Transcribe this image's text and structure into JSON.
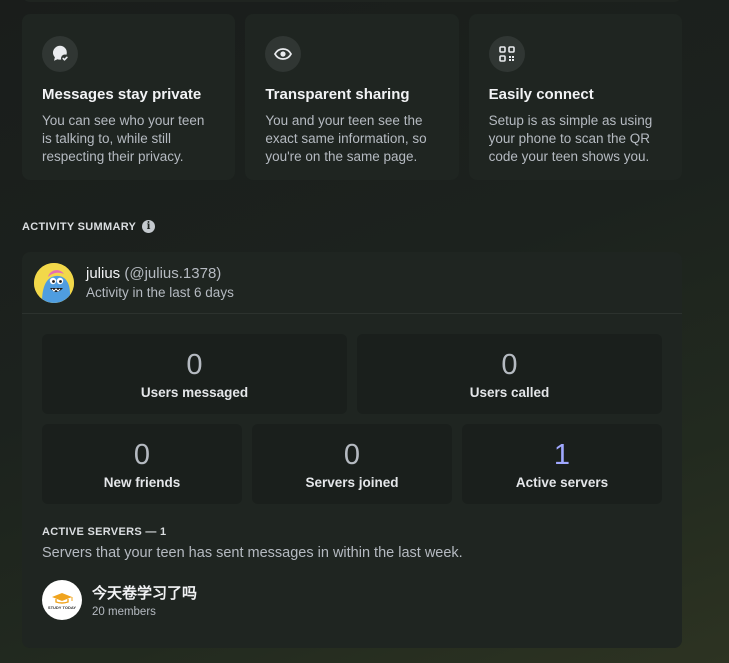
{
  "features": [
    {
      "icon": "chat-check-icon",
      "title": "Messages stay private",
      "description": "You can see who your teen is talking to, while still respecting their privacy."
    },
    {
      "icon": "eye-icon",
      "title": "Transparent sharing",
      "description": "You and your teen see the exact same information, so you're on the same page."
    },
    {
      "icon": "qr-code-icon",
      "title": "Easily connect",
      "description": "Setup is as simple as using your phone to scan the QR code your teen shows you."
    }
  ],
  "activity_summary": {
    "label": "ACTIVITY SUMMARY",
    "user": {
      "name": "julius",
      "handle": "(@julius.1378)",
      "subtitle": "Activity in the last 6 days"
    },
    "stats": [
      {
        "value": "0",
        "label": "Users messaged"
      },
      {
        "value": "0",
        "label": "Users called"
      },
      {
        "value": "0",
        "label": "New friends"
      },
      {
        "value": "0",
        "label": "Servers joined"
      },
      {
        "value": "1",
        "label": "Active servers"
      }
    ],
    "active_servers": {
      "heading": "ACTIVE SERVERS — 1",
      "description": "Servers that your teen has sent messages in within the last week.",
      "items": [
        {
          "name": "今天卷学习了吗",
          "members": "20 members",
          "icon_text": "STUDY TODAY"
        }
      ]
    }
  },
  "colors": {
    "accent": "#a0a8ff",
    "card": "#1f2521",
    "stat_card": "#1a1f1c"
  }
}
